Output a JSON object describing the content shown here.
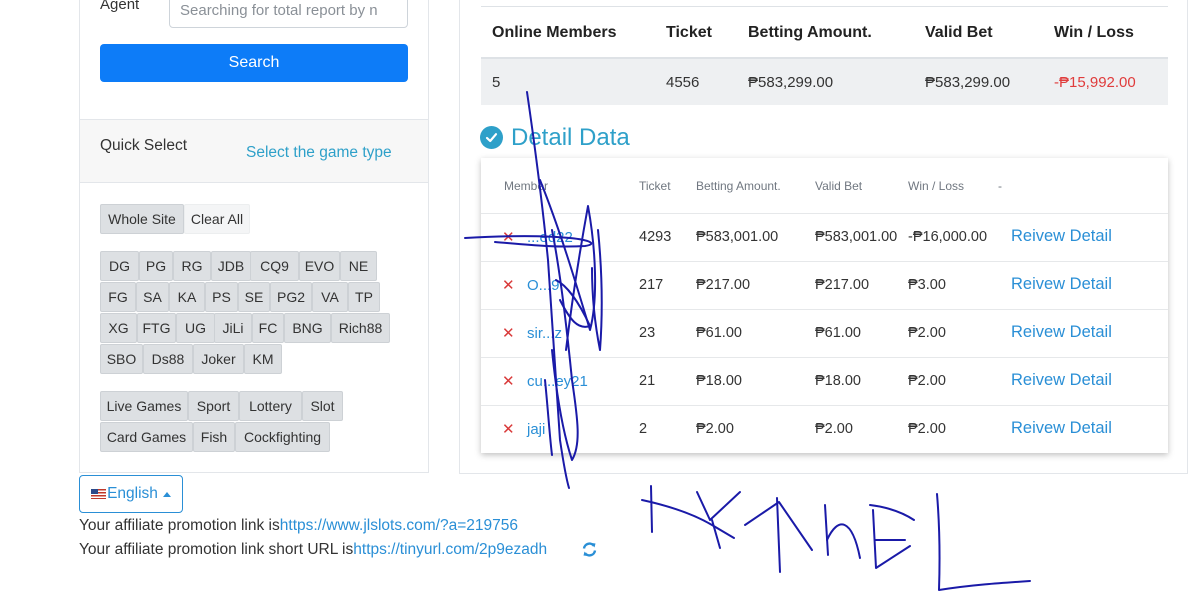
{
  "filter": {
    "agent_label": "Agent",
    "agent_placeholder": "Searching for total report by n",
    "search_label": "Search"
  },
  "quick_select": {
    "title": "Quick Select",
    "select_link": "Select the game type",
    "whole_site": "Whole Site",
    "clear_all": "Clear All",
    "providers": [
      "DG",
      "PG",
      "RG",
      "JDB",
      "CQ9",
      "EVO",
      "NE",
      "FG",
      "SA",
      "KA",
      "PS",
      "SE",
      "PG2",
      "VA",
      "TP",
      "XG",
      "FTG",
      "UG",
      "JiLi",
      "FC",
      "BNG",
      "Rich88",
      "SBO",
      "Ds88",
      "Joker",
      "KM"
    ],
    "game_types": [
      "Live Games",
      "Sport",
      "Lottery",
      "Slot",
      "Card Games",
      "Fish",
      "Cockfighting"
    ]
  },
  "summary": {
    "headers": [
      "Online Members",
      "Ticket",
      "Betting Amount.",
      "Valid Bet",
      "Win / Loss"
    ],
    "row": [
      "5",
      "4556",
      "₱583,299.00",
      "₱583,299.00",
      "-₱15,992.00"
    ]
  },
  "detail": {
    "title": "Detail Data",
    "headers": [
      "Member",
      "Ticket",
      "Betting Amount.",
      "Valid Bet",
      "Win / Loss",
      "-"
    ],
    "rows": [
      {
        "member": "...ed22",
        "ticket": "4293",
        "betting": "₱583,001.00",
        "valid": "₱583,001.00",
        "winloss": "-₱16,000.00",
        "status": "neg",
        "action": "Reivew Detail"
      },
      {
        "member": "O...9",
        "ticket": "217",
        "betting": "₱217.00",
        "valid": "₱217.00",
        "winloss": "₱3.00",
        "status": "pos",
        "action": "Reivew Detail"
      },
      {
        "member": "sir...z",
        "ticket": "23",
        "betting": "₱61.00",
        "valid": "₱61.00",
        "winloss": "₱2.00",
        "status": "pos",
        "action": "Reivew Detail"
      },
      {
        "member": "cu...ey21",
        "ticket": "21",
        "betting": "₱18.00",
        "valid": "₱18.00",
        "winloss": "₱2.00",
        "status": "pos",
        "action": "Reivew Detail"
      },
      {
        "member": "jaji",
        "ticket": "2",
        "betting": "₱2.00",
        "valid": "₱2.00",
        "winloss": "₱2.00",
        "status": "pos",
        "action": "Reivew Detail"
      }
    ]
  },
  "footer": {
    "language": "English",
    "promo_text": "Your affiliate promotion link is",
    "promo_url": "https://www.jlslots.com/?a=219756",
    "short_text": "Your affiliate promotion link short URL is",
    "short_url": "https://tinyurl.com/2p9ezadh"
  },
  "colors": {
    "primary": "#0d7cf8",
    "accent": "#2ea0c9",
    "link": "#2a8fd6",
    "negative": "#e03c3c",
    "positive": "#2aa84a",
    "ink": "#1a1aa8"
  },
  "handwriting": "KYKhEL"
}
